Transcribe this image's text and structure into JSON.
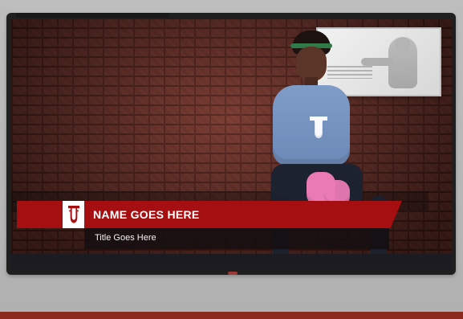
{
  "lower_third": {
    "name": "NAME GOES HERE",
    "title": "Title Goes Here"
  },
  "branding": {
    "logo_icon": "iu-trident-logo-icon",
    "primary_color": "#a60f12",
    "logo_color": "#a60f12"
  }
}
